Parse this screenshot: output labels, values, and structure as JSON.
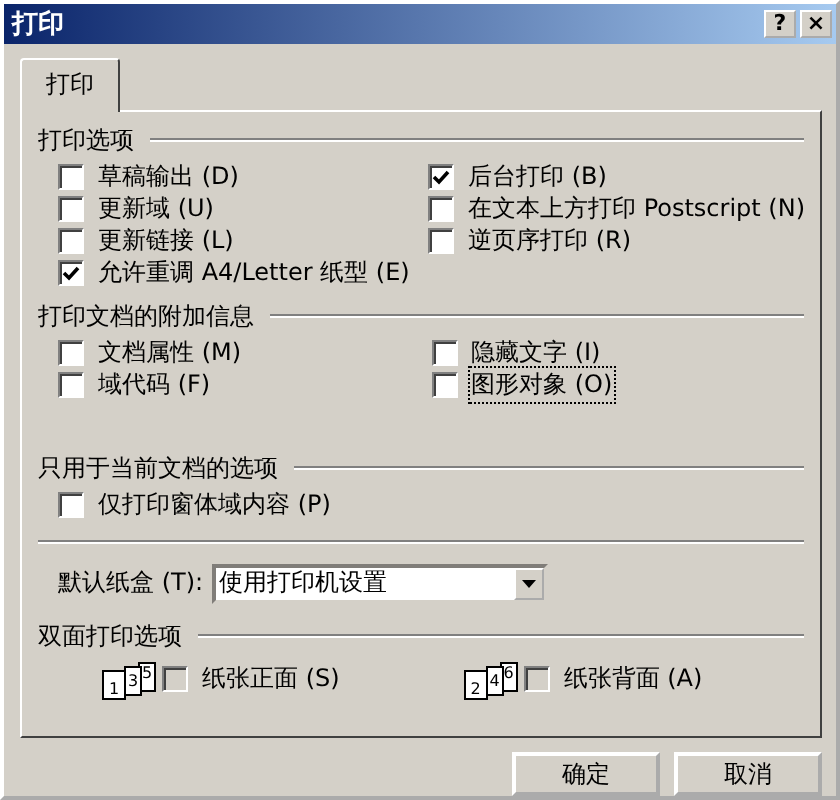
{
  "window": {
    "title": "打印",
    "help": "?",
    "close": "×"
  },
  "tabs": [
    {
      "label": "打印",
      "selected": true
    }
  ],
  "print_options": {
    "heading": "打印选项",
    "left": [
      {
        "label": "草稿输出 (D)",
        "checked": false,
        "focused": false
      },
      {
        "label": "更新域 (U)",
        "checked": false,
        "focused": false
      },
      {
        "label": "更新链接 (L)",
        "checked": false,
        "focused": false
      },
      {
        "label": "允许重调 A4/Letter 纸型 (E)",
        "checked": true,
        "focused": false
      }
    ],
    "right": [
      {
        "label": "后台打印 (B)",
        "checked": true,
        "focused": false
      },
      {
        "label": "在文本上方打印 Postscript (N)",
        "checked": false,
        "focused": false
      },
      {
        "label": "逆页序打印 (R)",
        "checked": false,
        "focused": false
      }
    ]
  },
  "extra_info": {
    "heading": "打印文档的附加信息",
    "left": [
      {
        "label": "文档属性 (M)",
        "checked": false,
        "focused": false
      },
      {
        "label": "域代码 (F)",
        "checked": false,
        "focused": false
      }
    ],
    "right": [
      {
        "label": "隐藏文字 (I)",
        "checked": false,
        "focused": false
      },
      {
        "label": "图形对象 (O)",
        "checked": false,
        "focused": true
      }
    ]
  },
  "current_doc": {
    "heading": "只用于当前文档的选项",
    "left": [
      {
        "label": "仅打印窗体域内容 (P)",
        "checked": false,
        "focused": false
      }
    ]
  },
  "tray": {
    "label": "默认纸盒 (T):",
    "value": "使用打印机设置"
  },
  "duplex": {
    "heading": "双面打印选项",
    "items": [
      {
        "pages": [
          "1",
          "3",
          "5"
        ],
        "label": "纸张正面 (S)",
        "checked": false,
        "disabled": true
      },
      {
        "pages": [
          "2",
          "4",
          "6"
        ],
        "label": "纸张背面 (A)",
        "checked": false,
        "disabled": true
      }
    ]
  },
  "buttons": [
    "确定",
    "取消"
  ]
}
